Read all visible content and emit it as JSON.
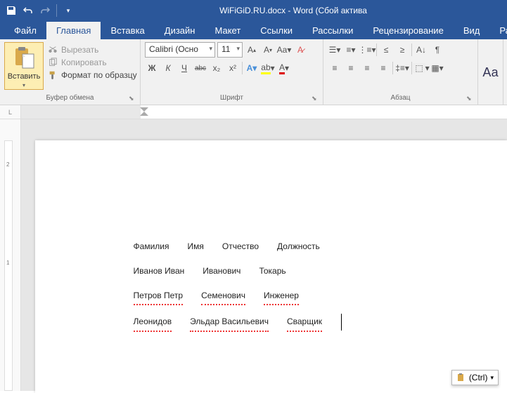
{
  "title": "WiFiGiD.RU.docx - Word (Сбой актива",
  "tabs": [
    "Файл",
    "Главная",
    "Вставка",
    "Дизайн",
    "Макет",
    "Ссылки",
    "Рассылки",
    "Рецензирование",
    "Вид",
    "Разрабо"
  ],
  "active_tab": 1,
  "clipboard": {
    "paste_label": "Вставить",
    "cut_label": "Вырезать",
    "copy_label": "Копировать",
    "format_painter_label": "Формат по образцу",
    "group_label": "Буфер обмена"
  },
  "font": {
    "name": "Calibri (Осно",
    "size": "11",
    "group_label": "Шрифт",
    "bold": "Ж",
    "italic": "К",
    "underline": "Ч",
    "strike": "abc",
    "sub": "x₂",
    "sup": "x²"
  },
  "paragraph": {
    "group_label": "Абзац"
  },
  "styles_hint": "Аа",
  "document": {
    "lines": [
      [
        {
          "t": "Фамилия",
          "e": 0
        },
        {
          "t": "Имя",
          "e": 0
        },
        {
          "t": "Отчество",
          "e": 0
        },
        {
          "t": "Должность",
          "e": 0
        }
      ],
      [
        {
          "t": "Иванов Иван",
          "e": 0
        },
        {
          "t": "Иванович",
          "e": 0
        },
        {
          "t": "Токарь",
          "e": 0
        }
      ],
      [
        {
          "t": "Петров Петр",
          "e": 1
        },
        {
          "t": "Семенович",
          "e": 1
        },
        {
          "t": "Инженер",
          "e": 1
        }
      ],
      [
        {
          "t": "Леонидов",
          "e": 1
        },
        {
          "t": "Эльдар Васильевич",
          "e": 1
        },
        {
          "t": "Сварщик",
          "e": 1
        }
      ]
    ]
  },
  "paste_popup": "(Ctrl)",
  "ruler_corner": "L"
}
